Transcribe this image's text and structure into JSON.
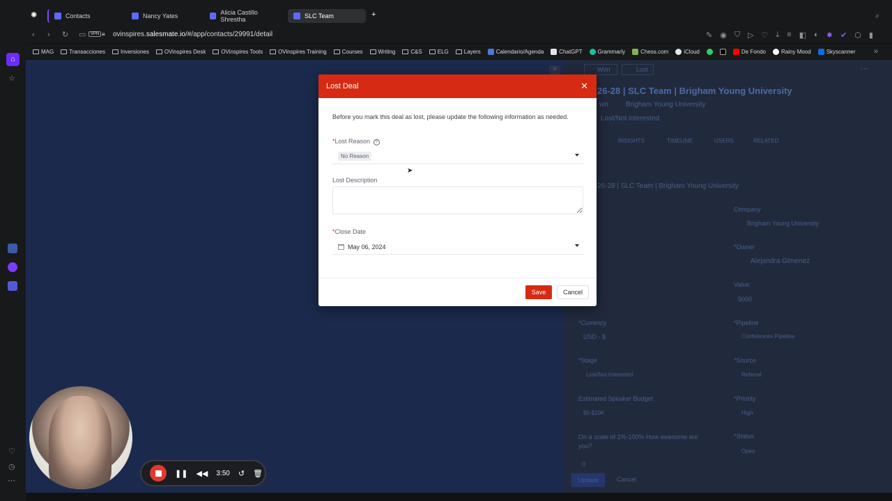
{
  "tabs": [
    {
      "label": "Contacts",
      "active": false
    },
    {
      "label": "Nancy Yates",
      "active": false
    },
    {
      "label": "Alicia Castillo Shrestha",
      "active": false
    },
    {
      "label": "SLC Team",
      "active": true
    }
  ],
  "address": {
    "url_prefix": "ovinspires.",
    "url_host": "salesmate.io",
    "url_path": "/#/app/contacts/29991/detail",
    "vpn_label": "VPN"
  },
  "bookmarks": [
    {
      "label": "MAG",
      "icon": "folder-icon"
    },
    {
      "label": "Transacciones",
      "icon": "folder-icon"
    },
    {
      "label": "Inversiones",
      "icon": "folder-icon"
    },
    {
      "label": "OVinspires Desk",
      "icon": "folder-icon"
    },
    {
      "label": "OVinspires Tools",
      "icon": "folder-icon"
    },
    {
      "label": "OVinspires Training",
      "icon": "folder-icon"
    },
    {
      "label": "Courses",
      "icon": "folder-icon"
    },
    {
      "label": "Writing",
      "icon": "folder-icon"
    },
    {
      "label": "C&S",
      "icon": "folder-icon"
    },
    {
      "label": "ELG",
      "icon": "folder-icon"
    },
    {
      "label": "Layers",
      "icon": "folder-icon"
    },
    {
      "label": "Calendario/Agenda",
      "icon": "calendar-icon"
    },
    {
      "label": "ChatGPT",
      "icon": "chatgpt-icon"
    },
    {
      "label": "Grammarly",
      "icon": "grammarly-icon"
    },
    {
      "label": "Chess.com",
      "icon": "chess-icon"
    },
    {
      "label": "iCloud",
      "icon": "apple-icon"
    },
    {
      "label": "De Fondo",
      "icon": "youtube-icon"
    },
    {
      "label": "Rainy Mood",
      "icon": "rainy-mood-icon"
    },
    {
      "label": "Skyscanner",
      "icon": "skyscanner-icon"
    }
  ],
  "background": {
    "deal_title": "26-28 | SLC Team | Brigham Young University",
    "owner_label": "wn",
    "company": "Brigham Young University",
    "status_text": "Lost/Not interested",
    "tabs": [
      "INSIGHTS",
      "TIMELINE",
      "USERS",
      "RELATED"
    ],
    "header_buttons": [
      "Won",
      "Lost"
    ],
    "fields": [
      {
        "label": "Company",
        "value": "Brigham Young University"
      },
      {
        "label": "*Owner",
        "value": "Alejandra Gimenez"
      },
      {
        "label": "Value",
        "value": "5000"
      },
      {
        "label": "*Currency",
        "value": "USD - $"
      },
      {
        "label": "*Pipeline",
        "value": "Conferences Pipeline"
      },
      {
        "label": "*Stage",
        "value": "Lost/Not interested"
      },
      {
        "label": "*Source",
        "value": "Referral"
      },
      {
        "label": "Estimated Speaker Budget",
        "value": "$5-$10K"
      },
      {
        "label": "*Priority",
        "value": "High"
      },
      {
        "label": "On a scale of 1%-100% How awesome are you?",
        "value": "0"
      },
      {
        "label": "*Status",
        "value": "Open"
      }
    ],
    "update_label": "Update",
    "cancel_label": "Cancel"
  },
  "modal": {
    "title": "Lost Deal",
    "intro": "Before you mark this deal as lost, please update the following information as needed.",
    "lost_reason_label": "Lost Reason",
    "lost_reason_value": "No Reason",
    "lost_description_label": "Lost Description",
    "lost_description_value": "",
    "close_date_label": "Close Date",
    "close_date_value": "May 06, 2024",
    "required_mark": "*",
    "save_label": "Save",
    "cancel_label": "Cancel"
  },
  "recorder": {
    "time": "3:50"
  },
  "colors": {
    "accent": "#d72a13",
    "app_bg": "#1b2a4c"
  }
}
